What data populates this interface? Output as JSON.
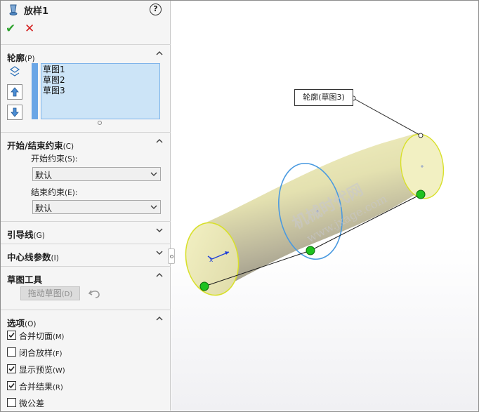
{
  "feature": {
    "title": "放样1",
    "help": "?",
    "ok": "✔",
    "cancel": "✕"
  },
  "profiles": {
    "title": "轮廓",
    "shortcut": "(P)",
    "items": [
      "草图1",
      "草图2",
      "草图3"
    ]
  },
  "constraints": {
    "title": "开始/结束约束",
    "shortcut": "(C)",
    "start_label": "开始约束",
    "start_shortcut": "(S):",
    "start_value": "默认",
    "end_label": "结束约束",
    "end_shortcut": "(E):",
    "end_value": "默认"
  },
  "guides": {
    "title": "引导线",
    "shortcut": "(G)"
  },
  "centerline": {
    "title": "中心线参数",
    "shortcut": "(I)"
  },
  "sketch_tools": {
    "title": "草图工具",
    "drag_label": "拖动草图",
    "drag_shortcut": "(D)"
  },
  "options": {
    "title": "选项",
    "shortcut": "(O)",
    "items": [
      {
        "label": "合并切面",
        "shortcut": "(M)",
        "checked": true
      },
      {
        "label": "闭合放样",
        "shortcut": "(F)",
        "checked": false
      },
      {
        "label": "显示预览",
        "shortcut": "(W)",
        "checked": true
      },
      {
        "label": "合并结果",
        "shortcut": "(R)",
        "checked": true
      },
      {
        "label": "微公差",
        "shortcut": "",
        "checked": false
      }
    ]
  },
  "viewport": {
    "callout": "轮廓(草图3)",
    "watermark_cn": "机械时代网",
    "watermark_url": "www.jxage.com",
    "colors": {
      "body": "#efedb8",
      "profile_edge": "#d8e02a",
      "selected_profile": "#4a9ae0",
      "connector_point": "#1fc21f"
    }
  }
}
